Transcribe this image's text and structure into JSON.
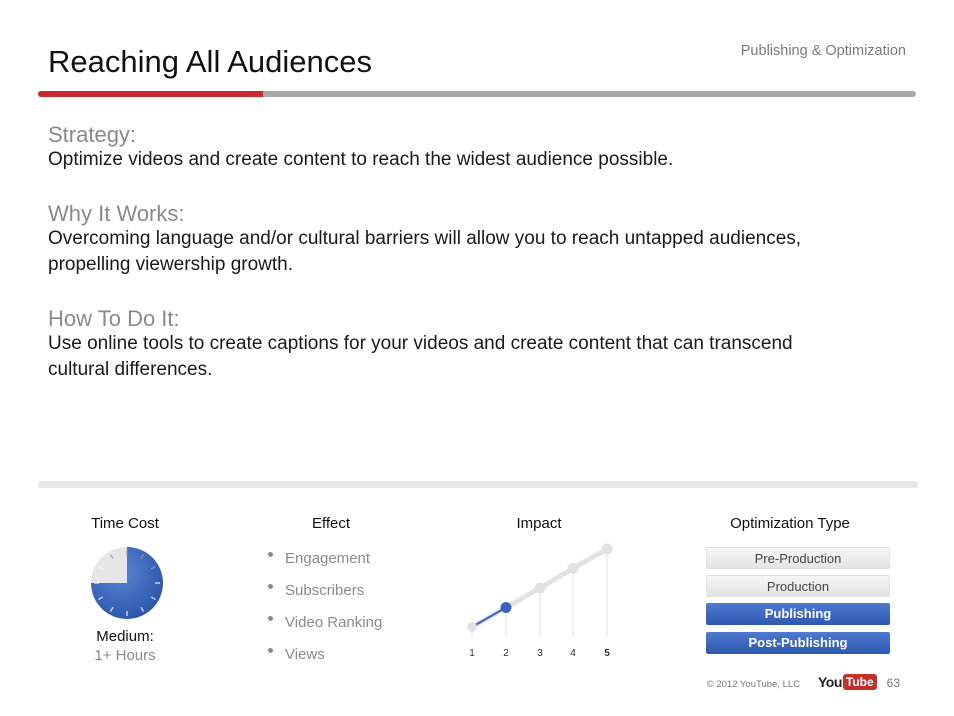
{
  "header": {
    "title": "Reaching All Audiences",
    "section": "Publishing & Optimization",
    "accent_color": "#cc2a2a"
  },
  "content": {
    "strategy": {
      "heading": "Strategy:",
      "text": "Optimize videos and create content to reach the widest audience possible."
    },
    "why": {
      "heading": "Why It Works:",
      "text": "Overcoming language and/or cultural barriers will allow you to reach untapped audiences, propelling viewership growth."
    },
    "how": {
      "heading": "How To Do It:",
      "text": "Use online tools to create captions for your videos and create content that can transcend cultural differences."
    }
  },
  "footer_panel": {
    "time_cost": {
      "label": "Time Cost",
      "value": "Medium:",
      "detail": "1+ Hours",
      "clock_fill_fraction": 0.75,
      "icon": "clock-icon"
    },
    "effect": {
      "label": "Effect",
      "items": [
        "Engagement",
        "Subscribers",
        "Video Ranking",
        "Views"
      ]
    },
    "impact": {
      "label": "Impact",
      "scale": [
        "1",
        "2",
        "3",
        "4",
        "5"
      ],
      "level": 2,
      "highlight_color": "#3a63c0"
    },
    "optimization_type": {
      "label": "Optimization Type",
      "options": [
        {
          "label": "Pre-Production",
          "active": false
        },
        {
          "label": "Production",
          "active": false
        },
        {
          "label": "Publishing",
          "active": true
        },
        {
          "label": "Post-Publishing",
          "active": true
        }
      ]
    }
  },
  "footer": {
    "copyright": "© 2012 YouTube, LLC",
    "logo_you": "You",
    "logo_tube": "Tube",
    "page_number": "63"
  }
}
